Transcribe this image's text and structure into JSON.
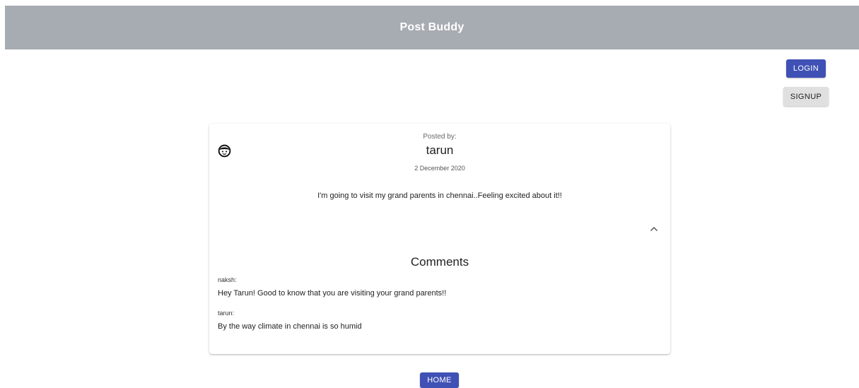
{
  "appbar": {
    "title": "Post Buddy"
  },
  "auth": {
    "login_label": "LOGIN",
    "signup_label": "SIGNUP"
  },
  "post": {
    "posted_by_label": "Posted by:",
    "author": "tarun",
    "date": "2 December 2020",
    "text": "I'm going to visit my grand parents in chennai..Feeling excited about it!!",
    "avatar_icon": "face-icon",
    "expand_icon": "chevron-up-icon"
  },
  "comments": {
    "title": "Comments",
    "items": [
      {
        "author": "naksh:",
        "text": "Hey Tarun! Good to know that you are visiting your grand parents!!"
      },
      {
        "author": "tarun:",
        "text": "By the way climate in chennai is so humid"
      }
    ]
  },
  "footer": {
    "home_label": "HOME"
  },
  "colors": {
    "appbar": "#a7abb2",
    "primary": "#3f51b5",
    "secondary_button": "#e0e0e0"
  }
}
